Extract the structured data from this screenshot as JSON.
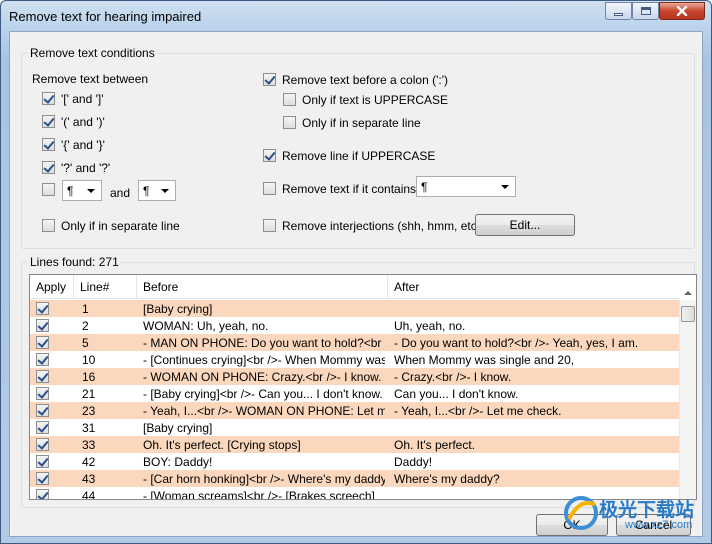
{
  "window": {
    "title": "Remove text for hearing impaired"
  },
  "conditions": {
    "group_label": "Remove text conditions",
    "between_label": "Remove text between",
    "square": {
      "label": "'[' and ']'",
      "checked": true
    },
    "round": {
      "label": "'(' and ')'",
      "checked": true
    },
    "curly": {
      "label": "'{' and '}'",
      "checked": true
    },
    "question": {
      "label": "'?' and '?'",
      "checked": true
    },
    "custom": {
      "checked": false,
      "start": "¶",
      "and_label": "and",
      "end": "¶"
    },
    "separate_line": {
      "label": "Only if in separate line",
      "checked": false
    },
    "colon": {
      "label": "Remove text before a colon (':')",
      "checked": true
    },
    "colon_uppercase": {
      "label": "Only if text is UPPERCASE",
      "checked": false
    },
    "colon_separate": {
      "label": "Only if in separate line",
      "checked": false
    },
    "line_uppercase": {
      "label": "Remove line if UPPERCASE",
      "checked": true
    },
    "contains": {
      "label": "Remove text if it contains:",
      "checked": false,
      "value": "¶"
    },
    "interjections": {
      "label": "Remove interjections (shh, hmm, etc.)",
      "checked": false,
      "edit_label": "Edit..."
    }
  },
  "lines": {
    "group_label": "Lines found: 271",
    "columns": [
      "Apply",
      "Line#",
      "Before",
      "After"
    ],
    "rows": [
      {
        "line": "1",
        "before": "[Baby crying]",
        "after": ""
      },
      {
        "line": "2",
        "before": "WOMAN: Uh, yeah, no.",
        "after": "Uh, yeah, no."
      },
      {
        "line": "5",
        "before": "- MAN ON PHONE: Do you want to hold?<br />...",
        "after": "- Do you want to hold?<br />- Yeah, yes, I am."
      },
      {
        "line": "10",
        "before": "- [Continues crying]<br />- When Mommy was ...",
        "after": "When Mommy was single and 20,"
      },
      {
        "line": "16",
        "before": "- WOMAN ON PHONE: Crazy.<br />- I know.",
        "after": "- Crazy.<br />- I know."
      },
      {
        "line": "21",
        "before": "- [Baby crying]<br />- Can you... I don't know.",
        "after": "Can you... I don't know."
      },
      {
        "line": "23",
        "before": "- Yeah, I...<br />- WOMAN ON PHONE: Let m...",
        "after": "- Yeah, I...<br />- Let me check."
      },
      {
        "line": "31",
        "before": "[Baby crying]",
        "after": ""
      },
      {
        "line": "33",
        "before": "Oh. It's perfect. [Crying stops]",
        "after": "Oh. It's perfect."
      },
      {
        "line": "42",
        "before": "BOY: Daddy!",
        "after": "Daddy!"
      },
      {
        "line": "43",
        "before": "- [Car horn honking]<br />- Where's my daddy?",
        "after": "Where's my daddy?"
      },
      {
        "line": "44",
        "before": "- [Woman screams]<br />- [Brakes screech]",
        "after": ""
      }
    ]
  },
  "buttons": {
    "ok": "OK",
    "cancel": "Cancel"
  },
  "watermark": {
    "text": "极光下载站",
    "url": "www.xz7.com"
  },
  "colors": {
    "row_highlight": "#fbd8bd"
  }
}
